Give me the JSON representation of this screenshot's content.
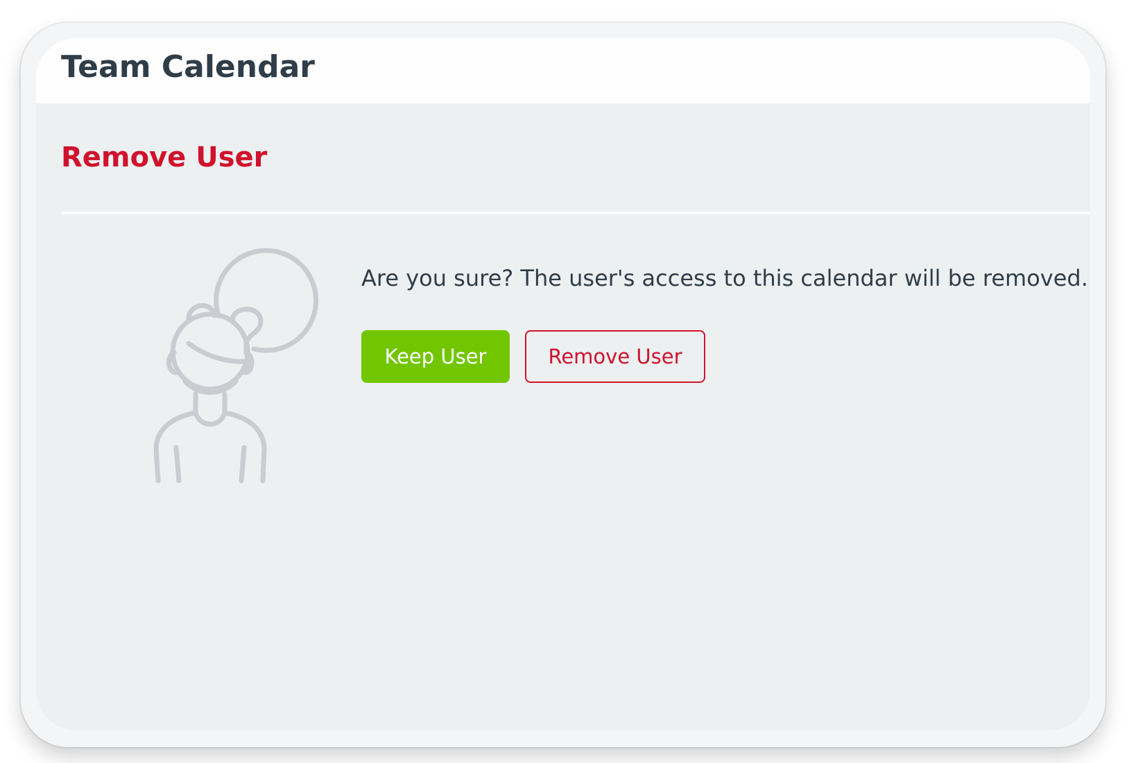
{
  "app": {
    "title": "Team Calendar"
  },
  "dialog": {
    "title": "Remove User",
    "message": "Are you sure? The user's access to this calendar will be removed.",
    "illustration_icon": "confused-user-question-icon",
    "buttons": {
      "keep_label": "Keep User",
      "remove_label": "Remove User"
    }
  },
  "colors": {
    "accent_danger": "#d0122c",
    "accent_success": "#71c600",
    "text_primary": "#2f3d49",
    "panel_background": "#edf0f1",
    "illustration_stroke": "#c9ccd0"
  }
}
